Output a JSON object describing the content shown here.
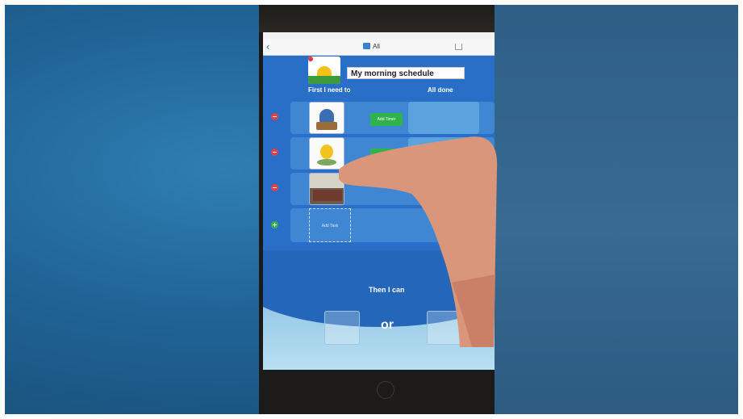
{
  "navbar": {
    "back_glyph": "‹",
    "title": "All"
  },
  "schedule": {
    "title": "My morning schedule",
    "first_label": "First I need to",
    "done_label": "All done",
    "then_label": "Then I can",
    "or_label": "or"
  },
  "rows": [
    {
      "timer_label": "Add Timer"
    },
    {
      "timer_label": "Add Timer"
    },
    {
      "timer_label": ""
    }
  ],
  "add_task_label": "Add Task",
  "colors": {
    "accent_blue": "#2a6fc7",
    "timer_green": "#2fb34a",
    "remove_red": "#e4404a"
  }
}
